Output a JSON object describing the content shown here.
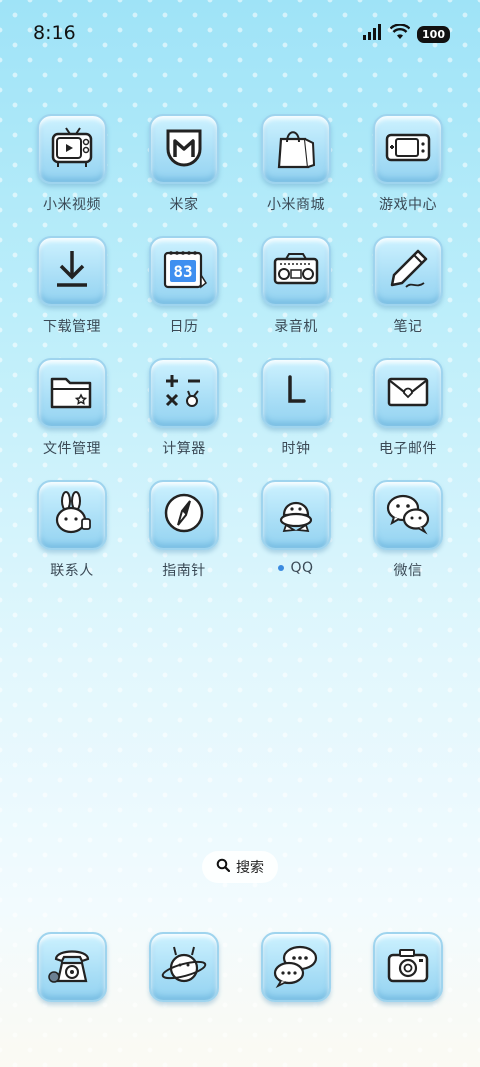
{
  "status": {
    "time": "8:16",
    "battery": "100"
  },
  "apps": [
    {
      "label": "小米视频",
      "icon": "tv-icon"
    },
    {
      "label": "米家",
      "icon": "mijia-icon"
    },
    {
      "label": "小米商城",
      "icon": "shopping-bag-icon"
    },
    {
      "label": "游戏中心",
      "icon": "game-console-icon"
    },
    {
      "label": "下载管理",
      "icon": "download-icon"
    },
    {
      "label": "日历",
      "icon": "calendar-icon",
      "day": "83"
    },
    {
      "label": "录音机",
      "icon": "radio-recorder-icon"
    },
    {
      "label": "笔记",
      "icon": "pencil-icon"
    },
    {
      "label": "文件管理",
      "icon": "folder-icon"
    },
    {
      "label": "计算器",
      "icon": "calculator-icon"
    },
    {
      "label": "时钟",
      "icon": "clock-icon"
    },
    {
      "label": "电子邮件",
      "icon": "envelope-icon"
    },
    {
      "label": "联系人",
      "icon": "bunny-contact-icon"
    },
    {
      "label": "指南针",
      "icon": "compass-icon"
    },
    {
      "label": "QQ",
      "icon": "qq-penguin-icon"
    },
    {
      "label": "微信",
      "icon": "wechat-icon"
    }
  ],
  "search": {
    "label": "搜索"
  },
  "dock": [
    {
      "icon": "telephone-icon"
    },
    {
      "icon": "browser-planet-icon"
    },
    {
      "icon": "messages-icon"
    },
    {
      "icon": "camera-icon"
    }
  ]
}
